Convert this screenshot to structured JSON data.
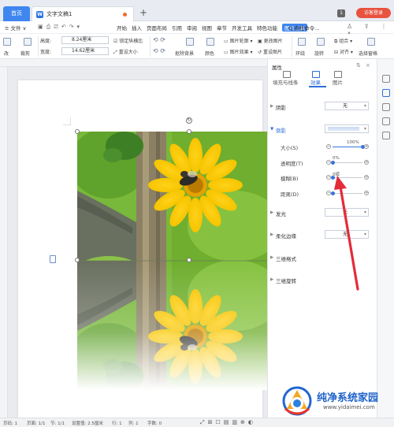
{
  "tabs": {
    "home": "首页",
    "doc": "文字文稿1",
    "login": "访客登录"
  },
  "menu": {
    "file": "≡ 文件 ∨",
    "items": [
      "开始",
      "插入",
      "页面布局",
      "引用",
      "审阅",
      "视图",
      "章节",
      "开发工具",
      "特色功能",
      "图片工具"
    ],
    "active_index": 9,
    "search": "Q 查找命令..."
  },
  "ribbon": {
    "height_label": "高度:",
    "height_value": "8.24厘米",
    "width_label": "宽度:",
    "width_value": "14.62厘米",
    "lock_ratio": "锁定纵横比",
    "reset_size": "重设大小",
    "crop": "裁剪",
    "remove_bg": "抠除背景",
    "color": "颜色",
    "picture_outline": "图片轮廓",
    "picture_effect": "图片效果",
    "change_picture": "更改图片",
    "reset_picture": "重设图片",
    "wrap": "环绕",
    "rotate": "旋转",
    "align": "对齐",
    "group": "组合",
    "select_pane": "选择窗格",
    "compress": "改"
  },
  "panel": {
    "title": "属性",
    "tabs": [
      "填充与线条",
      "效果",
      "图片"
    ],
    "active_tab": 1,
    "sections": {
      "shadow": {
        "label": "阴影",
        "value": "无"
      },
      "reflection": {
        "label": "倒影",
        "rows": [
          {
            "label": "大小(S)",
            "value": "100%",
            "level": 1.0
          },
          {
            "label": "透明度(T)",
            "value": "0%",
            "level": 0.0
          },
          {
            "label": "模糊(B)",
            "value": "0磅",
            "level": 0.0
          },
          {
            "label": "距离(D)",
            "value": "",
            "level": 0.0
          }
        ]
      },
      "glow": {
        "label": "发光",
        "value": "无"
      },
      "soft_edges": {
        "label": "柔化边缘",
        "value": "无"
      },
      "threed_format": {
        "label": "三维格式"
      },
      "threed_rotation": {
        "label": "三维旋转"
      }
    }
  },
  "status": {
    "page": "页码: 1",
    "pages": "页面: 1/1",
    "section": "节: 1/1",
    "setting": "设置值: 2.5厘米",
    "row": "行: 1",
    "col": "列: 1",
    "words": "字数: 0"
  },
  "watermark": {
    "title": "纯净系统家园",
    "url": "www.yidaimei.com"
  },
  "colors": {
    "accent": "#3f86f0",
    "login": "#e8523f",
    "arrow": "#e32b3a",
    "brand_blue": "#1f63c9"
  }
}
